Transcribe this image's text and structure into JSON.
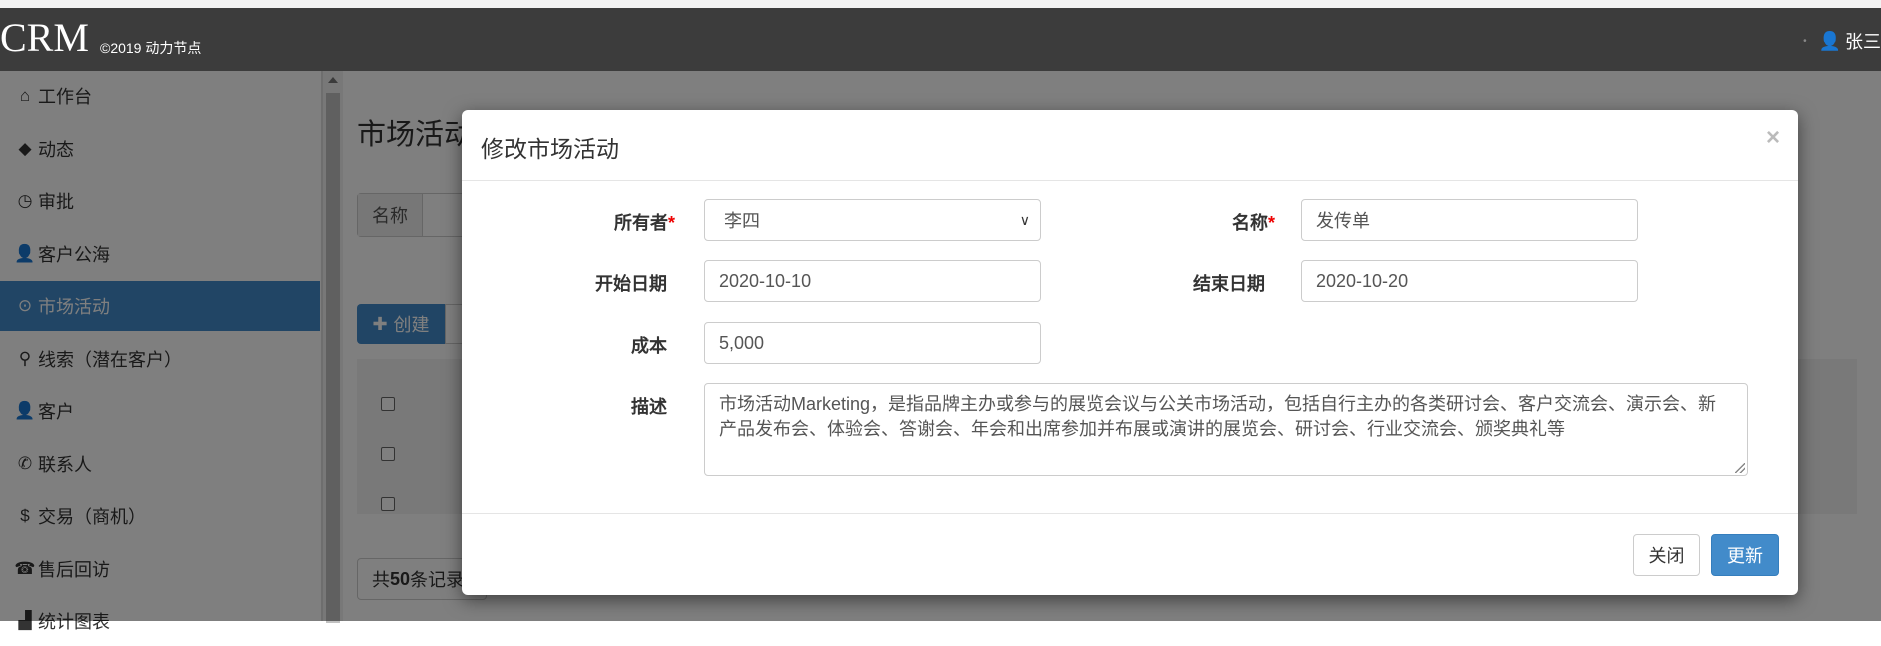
{
  "header": {
    "brand": "CRM",
    "copyright": "©2019 动力节点",
    "user_name": "张三"
  },
  "sidebar": {
    "items": [
      {
        "label": "工作台",
        "icon": "home-icon",
        "glyph": "⌂"
      },
      {
        "label": "动态",
        "icon": "tag-icon",
        "glyph": "◆"
      },
      {
        "label": "审批",
        "icon": "clock-icon",
        "glyph": "◷"
      },
      {
        "label": "客户公海",
        "icon": "user-icon",
        "glyph": "👤"
      },
      {
        "label": "市场活动",
        "icon": "play-circle-icon",
        "glyph": "⊙",
        "active": true
      },
      {
        "label": "线索（潜在客户）",
        "icon": "search-icon",
        "glyph": "⚲"
      },
      {
        "label": "客户",
        "icon": "user-icon",
        "glyph": "👤"
      },
      {
        "label": "联系人",
        "icon": "phone-icon",
        "glyph": "✆"
      },
      {
        "label": "交易（商机）",
        "icon": "dollar-icon",
        "glyph": "$"
      },
      {
        "label": "售后回访",
        "icon": "phone-alt-icon",
        "glyph": "☎"
      },
      {
        "label": "统计图表",
        "icon": "stats-icon",
        "glyph": "▟"
      }
    ]
  },
  "main": {
    "title": "市场活动",
    "search_label": "名称",
    "create_label": "创建",
    "pager_prefix": "共",
    "pager_count": "50",
    "pager_suffix": "条记录"
  },
  "modal": {
    "title": "修改市场活动",
    "close_glyph": "×",
    "owner_label": "所有者",
    "owner_value": "李四",
    "name_label": "名称",
    "name_value": "发传单",
    "start_label": "开始日期",
    "start_value": "2020-10-10",
    "end_label": "结束日期",
    "end_value": "2020-10-20",
    "cost_label": "成本",
    "cost_value": "5,000",
    "desc_label": "描述",
    "desc_value": "市场活动Marketing，是指品牌主办或参与的展览会议与公关市场活动，包括自行主办的各类研讨会、客户交流会、演示会、新产品发布会、体验会、答谢会、年会和出席参加并布展或演讲的展览会、研讨会、行业交流会、颁奖典礼等",
    "required_mark": "*",
    "close_button": "关闭",
    "update_button": "更新"
  },
  "colors": {
    "primary": "#428bca",
    "navbar": "#3c3c3c",
    "required": "#ee0000"
  }
}
